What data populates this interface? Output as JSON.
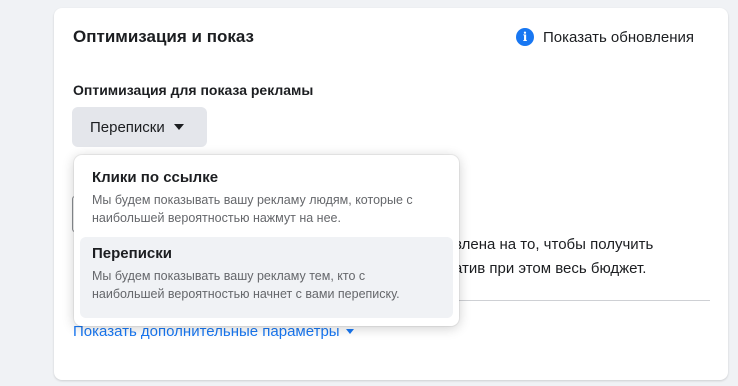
{
  "section": {
    "title": "Оптимизация и показ",
    "updates_label": "Показать обновления",
    "updates_icon": "info-icon"
  },
  "optimization": {
    "label": "Оптимизация для показа рекламы",
    "selected_value": "Переписки",
    "options": [
      {
        "title": "Клики по ссылке",
        "description": "Мы будем показывать вашу рекламу людям, которые с наибольшей вероятностью нажмут на нее.",
        "selected": false
      },
      {
        "title": "Переписки",
        "description": "Мы будем показывать вашу рекламу тем, кто с наибольшей вероятностью начнет с вами переписку.",
        "selected": true
      }
    ]
  },
  "background": {
    "text_line1": "влена на то, чтобы получить",
    "text_line2": "атив при этом весь бюджет."
  },
  "more_params_link": "Показать дополнительные параметры",
  "colors": {
    "accent": "#1877f2",
    "page_bg": "#f0f2f5",
    "selected_option_bg": "#f0f2f5",
    "button_bg": "#e4e6eb"
  }
}
